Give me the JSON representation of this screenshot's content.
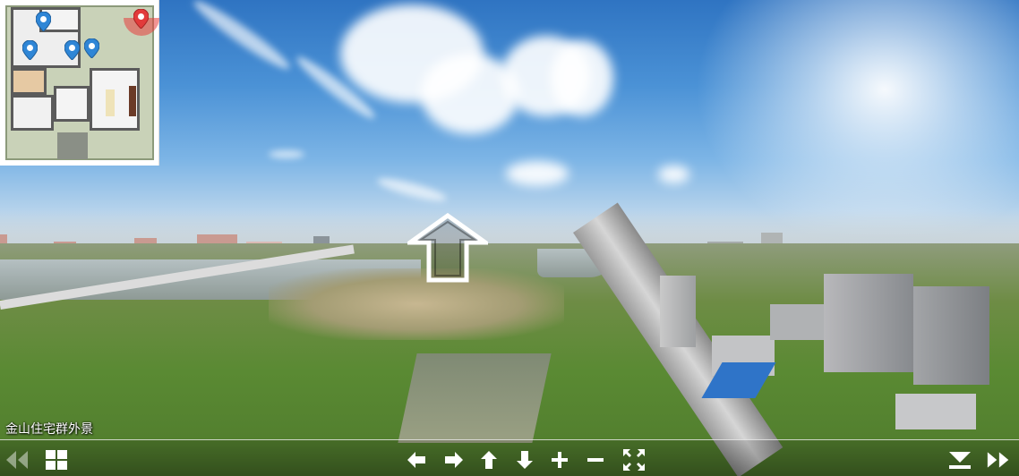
{
  "tour": {
    "scene_caption": "金山住宅群外景"
  },
  "minimap": {
    "pins": [
      {
        "icon": "map-pin-icon",
        "color": "#2f86d6"
      },
      {
        "icon": "map-pin-icon",
        "color": "#2f86d6"
      },
      {
        "icon": "map-pin-icon",
        "color": "#2f86d6"
      },
      {
        "icon": "map-pin-icon",
        "color": "#2f86d6"
      },
      {
        "icon": "map-pin-active-icon",
        "color": "#e23b3b"
      }
    ]
  },
  "hotspot": {
    "icon": "forward-arrow-icon",
    "direction": "forward"
  },
  "toolbar": {
    "buttons": [
      {
        "name": "previous-scene-button",
        "icon": "double-chevron-left-icon"
      },
      {
        "name": "thumbnails-button",
        "icon": "grid-icon"
      },
      {
        "name": "pan-left-button",
        "icon": "arrow-left-icon"
      },
      {
        "name": "pan-right-button",
        "icon": "arrow-right-icon"
      },
      {
        "name": "pan-up-button",
        "icon": "arrow-up-icon"
      },
      {
        "name": "pan-down-button",
        "icon": "arrow-down-icon"
      },
      {
        "name": "zoom-in-button",
        "icon": "plus-icon"
      },
      {
        "name": "zoom-out-button",
        "icon": "minus-icon"
      },
      {
        "name": "fullscreen-button",
        "icon": "fullscreen-icon"
      },
      {
        "name": "hide-controls-button",
        "icon": "collapse-down-icon"
      },
      {
        "name": "next-scene-button",
        "icon": "double-chevron-right-icon"
      }
    ]
  },
  "colors": {
    "active_pin": "#e23b3b",
    "pin": "#2f86d6",
    "toolbar_icon": "#ffffff"
  }
}
